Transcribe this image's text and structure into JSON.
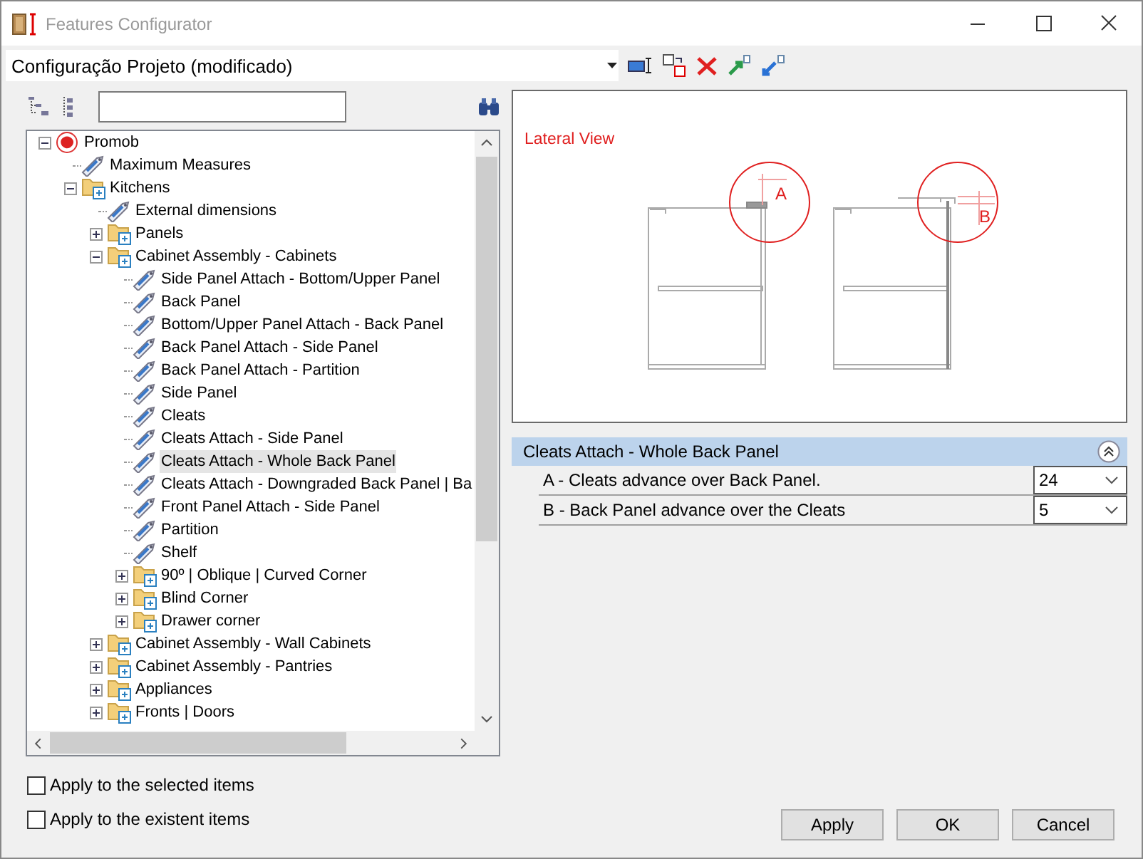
{
  "window": {
    "title": "Features Configurator"
  },
  "configuration": {
    "value": "Configuração Projeto (modificado)"
  },
  "tree": [
    {
      "label": "Promob",
      "kind": "root",
      "expanded": true,
      "selected": false,
      "children": [
        {
          "label": "Maximum Measures",
          "kind": "leaf",
          "selected": false
        },
        {
          "label": "Kitchens",
          "kind": "group",
          "expanded": true,
          "selected": false,
          "children": [
            {
              "label": "External dimensions",
              "kind": "leaf",
              "selected": false
            },
            {
              "label": "Panels",
              "kind": "group",
              "expanded": false,
              "selected": false
            },
            {
              "label": "Cabinet Assembly - Cabinets",
              "kind": "group",
              "expanded": true,
              "selected": false,
              "children": [
                {
                  "label": "Side Panel Attach - Bottom/Upper Panel",
                  "kind": "leaf",
                  "selected": false
                },
                {
                  "label": "Back Panel",
                  "kind": "leaf",
                  "selected": false
                },
                {
                  "label": "Bottom/Upper Panel Attach - Back Panel",
                  "kind": "leaf",
                  "selected": false
                },
                {
                  "label": "Back Panel Attach - Side Panel",
                  "kind": "leaf",
                  "selected": false
                },
                {
                  "label": "Back Panel Attach - Partition",
                  "kind": "leaf",
                  "selected": false
                },
                {
                  "label": "Side Panel",
                  "kind": "leaf",
                  "selected": false
                },
                {
                  "label": "Cleats",
                  "kind": "leaf",
                  "selected": false
                },
                {
                  "label": "Cleats Attach - Side Panel",
                  "kind": "leaf",
                  "selected": false
                },
                {
                  "label": "Cleats Attach - Whole Back Panel",
                  "kind": "leaf",
                  "selected": true
                },
                {
                  "label": "Cleats Attach - Downgraded Back Panel | Ba",
                  "kind": "leaf",
                  "selected": false
                },
                {
                  "label": "Front Panel Attach - Side Panel",
                  "kind": "leaf",
                  "selected": false
                },
                {
                  "label": "Partition",
                  "kind": "leaf",
                  "selected": false
                },
                {
                  "label": "Shelf",
                  "kind": "leaf",
                  "selected": false
                },
                {
                  "label": "90º | Oblique | Curved Corner",
                  "kind": "group",
                  "expanded": false,
                  "selected": false
                },
                {
                  "label": "Blind Corner",
                  "kind": "group",
                  "expanded": false,
                  "selected": false
                },
                {
                  "label": "Drawer corner",
                  "kind": "group",
                  "expanded": false,
                  "selected": false
                }
              ]
            },
            {
              "label": "Cabinet Assembly - Wall Cabinets",
              "kind": "group",
              "expanded": false,
              "selected": false
            },
            {
              "label": "Cabinet Assembly - Pantries",
              "kind": "group",
              "expanded": false,
              "selected": false
            },
            {
              "label": "Appliances",
              "kind": "group",
              "expanded": false,
              "selected": false
            },
            {
              "label": "Fronts | Doors",
              "kind": "group",
              "expanded": false,
              "selected": false
            }
          ]
        }
      ]
    }
  ],
  "preview": {
    "title": "Lateral View",
    "markers": [
      "A",
      "B"
    ]
  },
  "properties": {
    "group": "Cleats Attach - Whole Back Panel",
    "expanded": true,
    "rows": [
      {
        "label": "A - Cleats advance over Back Panel.",
        "value": "24"
      },
      {
        "label": "B - Back Panel advance over the Cleats",
        "value": "5"
      }
    ]
  },
  "options": [
    {
      "label": "Apply to the selected items",
      "checked": false
    },
    {
      "label": "Apply to the existent items",
      "checked": false
    }
  ],
  "buttons": [
    "Apply",
    "OK",
    "Cancel"
  ]
}
